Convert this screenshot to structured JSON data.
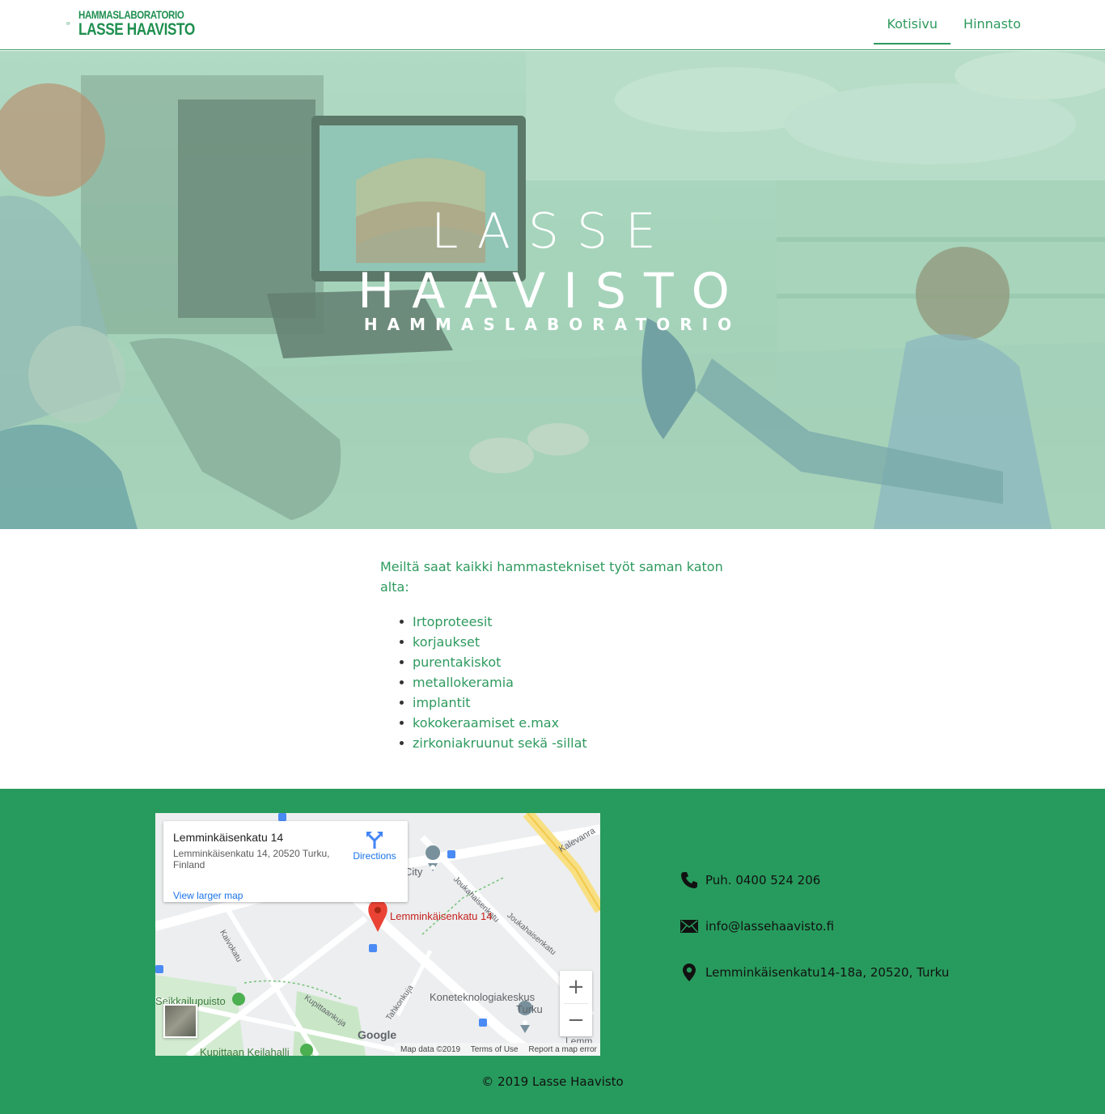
{
  "brand": {
    "logo_line1": "HAMMASLABORATORIO",
    "logo_line2": "LASSE HAAVISTO"
  },
  "nav": {
    "items": [
      {
        "label": "Kotisivu",
        "active": true
      },
      {
        "label": "Hinnasto",
        "active": false
      }
    ]
  },
  "hero": {
    "title_line1": "LASSE",
    "title_line2": "HAAVISTO",
    "subtitle": "HAMMASLABORATORIO"
  },
  "content": {
    "intro": "Meiltä saat kaikki hammastekniset työt saman katon alta:",
    "services": [
      "Irtoproteesit",
      "korjaukset",
      "purentakiskot",
      "metallokeramia",
      "implantit",
      "kokokeraamiset e.max",
      "zirkoniakruunut sekä -sillat"
    ]
  },
  "map": {
    "place_title": "Lemminkäisenkatu 14",
    "place_address": "Lemminkäisenkatu 14, 20520 Turku, Finland",
    "directions_label": "Directions",
    "larger_map_link": "View larger map",
    "pin_label": "Lemminkäisenkatu 14",
    "labels": {
      "city": "City",
      "joukahaisenkatu_1": "Joukahaisenkatu",
      "joukahaisenkatu_2": "Joukahaisenkatu",
      "kalevanraitti": "Kalevanra",
      "kaivokatu": "Kaivokatu",
      "seikkailupuisto": "Seikkailupuisto",
      "kupittaankuja": "Kupittaankuja",
      "tahkonkuja": "Tahkonkuja",
      "koneteknologiakeskus": "Koneteknologiakeskus",
      "turku": "Turku",
      "kupittaan_keilahalli": "Kupittaan Keilahalli",
      "lemmi": "Lemm"
    },
    "zoom_in": "+",
    "zoom_out": "−",
    "google_logo": "Google",
    "map_data": "Map data ©2019",
    "terms": "Terms of Use",
    "report": "Report a map error"
  },
  "contact": {
    "phone": "Puh. 0400 524 206",
    "email": "info@lassehaavisto.fi",
    "address": "Lemminkäisenkatu14-18a, 20520, Turku"
  },
  "footer": {
    "copyright": "© 2019 Lasse Haavisto"
  },
  "colors": {
    "brand_green": "#2e9a5e",
    "footer_green": "#279b5d"
  }
}
